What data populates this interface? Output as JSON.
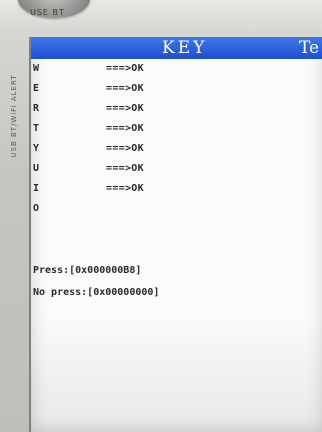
{
  "device": {
    "knob_label": "USE BT",
    "side_label": "USB BT/WiFi ALERT"
  },
  "screen": {
    "title": "KEY",
    "title_right_partial": "Te",
    "keys": [
      {
        "key": "W",
        "status": "===>OK"
      },
      {
        "key": "E",
        "status": "===>OK"
      },
      {
        "key": "R",
        "status": "===>OK"
      },
      {
        "key": "T",
        "status": "===>OK"
      },
      {
        "key": "Y",
        "status": "===>OK"
      },
      {
        "key": "U",
        "status": "===>OK"
      },
      {
        "key": "I",
        "status": "===>OK"
      },
      {
        "key": "O",
        "status": ""
      }
    ],
    "press_line": "Press:[0x000000B8]",
    "no_press_line": "No press:[0x00000000]"
  },
  "colors": {
    "title_bar": "#1d4fd0",
    "screen_bg": "#fbfbfa",
    "text": "#2a2a2a",
    "bezel": "#c8c9c6"
  }
}
